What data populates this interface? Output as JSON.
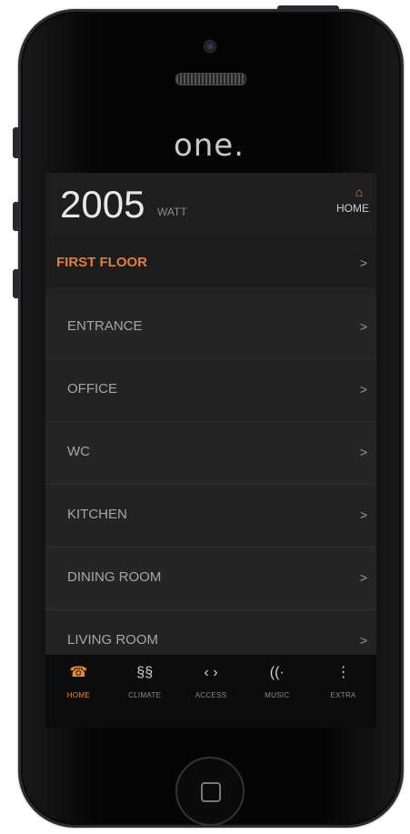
{
  "device": {
    "logo": "one."
  },
  "header": {
    "power_value": "2005",
    "power_unit": "WATT",
    "home_label": "HOME",
    "home_icon": "house-icon"
  },
  "floor": {
    "label": "FIRST FLOOR",
    "chevron": ">"
  },
  "rooms": [
    {
      "label": "ENTRANCE",
      "chevron": ">"
    },
    {
      "label": "OFFICE",
      "chevron": ">"
    },
    {
      "label": "WC",
      "chevron": ">"
    },
    {
      "label": "KITCHEN",
      "chevron": ">"
    },
    {
      "label": "DINING ROOM",
      "chevron": ">"
    },
    {
      "label": "LIVING ROOM",
      "chevron": ">"
    }
  ],
  "tabs": [
    {
      "label": "HOME",
      "icon": "home-icon",
      "glyph": "☎",
      "active": true
    },
    {
      "label": "CLIMATE",
      "icon": "climate-icon",
      "glyph": "§§",
      "active": false
    },
    {
      "label": "ACCESS",
      "icon": "access-icon",
      "glyph": "‹ ›",
      "active": false
    },
    {
      "label": "MUSIC",
      "icon": "music-icon",
      "glyph": "((·",
      "active": false
    },
    {
      "label": "EXTRA",
      "icon": "extra-icon",
      "glyph": "⋮",
      "active": false
    }
  ],
  "colors": {
    "accent": "#e88a2e",
    "background": "#222222"
  }
}
